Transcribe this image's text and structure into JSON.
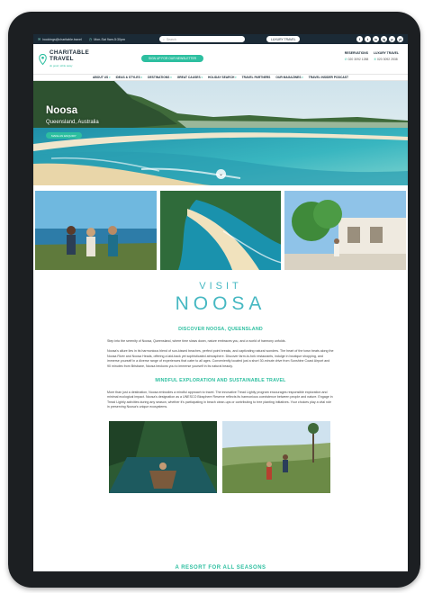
{
  "topbar": {
    "email": "bookings@charitable.travel",
    "hours": "Mon-Sat 9am-5:30pm",
    "search_placeholder": "Search",
    "luxury_button": "LUXURY TRAVEL",
    "socials": [
      "f",
      "t",
      "in",
      "ig",
      "p",
      "yt"
    ]
  },
  "header": {
    "logo_line1": "CHARITABLE",
    "logo_line2": "TRAVEL",
    "logo_tagline": "do good, while away",
    "newsletter_button": "SIGN UP FOR OUR NEWSLETTER",
    "contact_label_1": "RESERVATIONS",
    "contact_label_2": "LUXURY TRAVEL",
    "phone_1": "020 3092 1288",
    "phone_2": "020 3092 2538"
  },
  "nav": {
    "items": [
      "ABOUT US",
      "IDEAS & STYLES",
      "DESTINATIONS",
      "GREAT CAUSES",
      "HOLIDAY SEARCH",
      "TRAVEL PARTNERS",
      "OUR MAGAZINES",
      "TRAVEL INSIDER PODCAST"
    ],
    "has_dropdown": [
      true,
      true,
      true,
      true,
      true,
      false,
      true,
      false
    ]
  },
  "hero": {
    "title": "Noosa",
    "subtitle": "Queensland, Australia",
    "button": "MAKE AN ENQUIRY"
  },
  "visit": {
    "small": "VISIT",
    "big": "NOOSA"
  },
  "content": {
    "discover_heading": "DISCOVER NOOSA, QUEENSLAND",
    "intro_text": "Step into the serenity of Noosa, Queensland, where time slows down, nature embraces you, and a world of harmony unfolds.",
    "allure_text": "Noosa's allure lies in its harmonious blend of sun-kissed beaches, perfect point breaks, and captivating natural wonders. The heart of the town beats along the Noosa River and Noosa Heads, offering a laid-back yet sophisticated atmosphere. Discover farm-to-fork restaurants, indulge in boutique shopping, and immerse yourself in a diverse range of experiences that cater to all ages. Conveniently located just a short 30-minute drive from Sunshine Coast Airport and 90 minutes from Brisbane, Noosa beckons you to immerse yourself in its natural beauty.",
    "mindful_heading": "MINDFUL EXPLORATION AND SUSTAINABLE TRAVEL",
    "mindful_text": "More than just a destination, Noosa embodies a mindful approach to travel. The innovative Tread Lightly program encourages responsible exploration and minimal ecological impact. Noosa's designation as a UNESCO Biosphere Reserve reflects its harmonious coexistence between people and nature. Engage in Tread Lightly activities during any season, whether it's participating in beach clean-ups or contributing to tree planting initiatives. Your choices play a vital role in preserving Noosa's unique ecosystems.",
    "bottom_heading": "A RESORT FOR ALL SEASONS"
  },
  "colors": {
    "teal": "#2dbfa0",
    "navy": "#1b2a36",
    "visit_blue": "#46b8c2"
  }
}
